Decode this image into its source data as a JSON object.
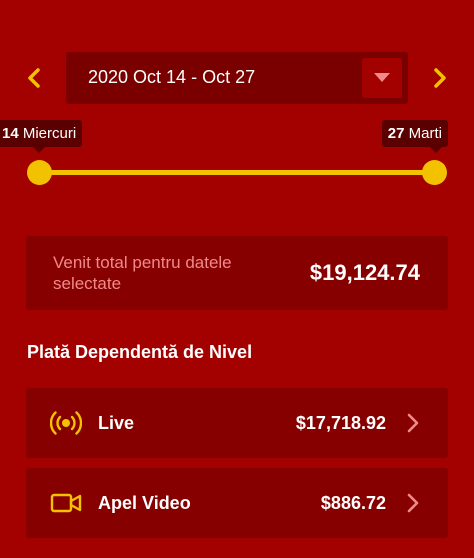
{
  "date_range": {
    "label": "2020 Oct 14 - Oct 27",
    "start_day": "14",
    "start_weekday": "Miercuri",
    "end_day": "27",
    "end_weekday": "Marti"
  },
  "total": {
    "label": "Venit total pentru datele selectate",
    "value": "$19,124.74"
  },
  "section": {
    "title": "Plată Dependentă de Nivel"
  },
  "payments": [
    {
      "label": "Live",
      "amount": "$17,718.92",
      "icon": "live-broadcast-icon"
    },
    {
      "label": "Apel Video",
      "amount": "$886.72",
      "icon": "video-camera-icon"
    }
  ],
  "colors": {
    "background": "#a30000",
    "card": "#870000",
    "date_box": "#7a0000",
    "accent": "#f2c200",
    "muted_text": "#f08a8a",
    "chevron": "#f08a8a"
  }
}
